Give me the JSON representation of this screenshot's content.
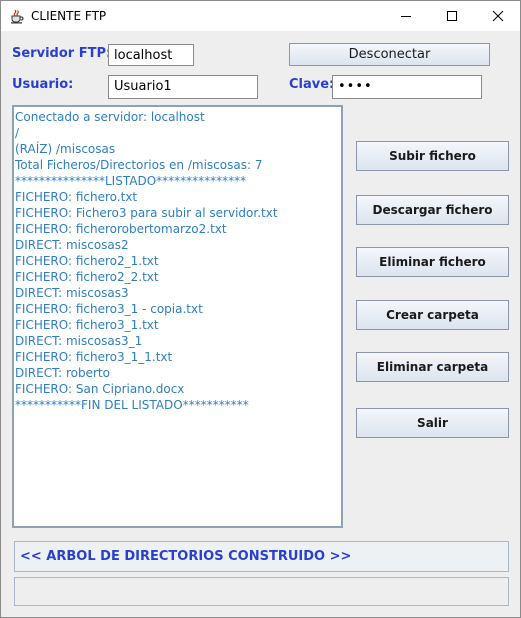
{
  "window": {
    "title": "CLIENTE FTP",
    "app_icon": "java-cup-icon"
  },
  "controls": {
    "minimize_icon": "minimize-icon",
    "maximize_icon": "maximize-icon",
    "close_icon": "close-icon"
  },
  "form": {
    "server_label": "Servidor FTP:",
    "server_value": "localhost",
    "disconnect_label": "Desconectar",
    "user_label": "Usuario:",
    "user_value": "Usuario1",
    "password_label": "Clave:",
    "password_value": "••••"
  },
  "listing": [
    "Conectado a servidor: localhost",
    "/",
    "(RAÍZ) /miscosas",
    "Total Ficheros/Directorios en /miscosas: 7",
    "***************LISTADO***************",
    "FICHERO: fichero.txt",
    "FICHERO: Fichero3 para subir al servidor.txt",
    "FICHERO: ficherorobertomarzo2.txt",
    "DIRECT: miscosas2",
    "FICHERO: fichero2_1.txt",
    "FICHERO: fichero2_2.txt",
    "DIRECT: miscosas3",
    "FICHERO: fichero3_1 - copia.txt",
    "FICHERO: fichero3_1.txt",
    "DIRECT: miscosas3_1",
    "FICHERO: fichero3_1_1.txt",
    "DIRECT: roberto",
    "FICHERO: San Cipriano.docx",
    "***********FIN DEL LISTADO***********"
  ],
  "actions": {
    "upload": "Subir fichero",
    "download": "Descargar fichero",
    "delete_file": "Eliminar fichero",
    "create_folder": "Crear carpeta",
    "delete_folder": "Eliminar carpeta",
    "exit": "Salir"
  },
  "status": {
    "message": "<< ARBOL DE DIRECTORIOS CONSTRUIDO >>",
    "secondary": ""
  },
  "colors": {
    "label": "#2a3fcf",
    "listing_text": "#2f7ec1",
    "background": "#eeeeee"
  }
}
